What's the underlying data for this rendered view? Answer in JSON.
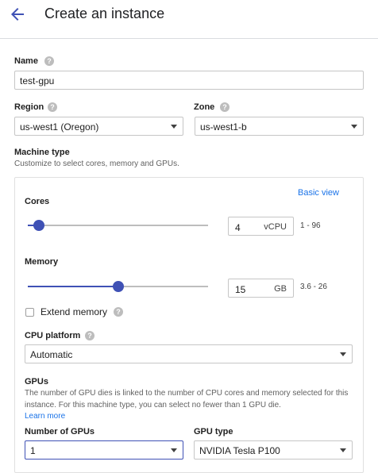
{
  "header": {
    "title": "Create an instance",
    "back_icon": "arrow-back-icon"
  },
  "name": {
    "label": "Name",
    "value": "test-gpu"
  },
  "region": {
    "label": "Region",
    "value": "us-west1 (Oregon)"
  },
  "zone": {
    "label": "Zone",
    "value": "us-west1-b"
  },
  "machine_type": {
    "label": "Machine type",
    "description": "Customize to select cores, memory and GPUs.",
    "basic_view_link": "Basic view",
    "cores": {
      "label": "Cores",
      "value": "4",
      "unit": "vCPU",
      "range": "1 - 96",
      "slider_fraction": 0.06
    },
    "memory": {
      "label": "Memory",
      "value": "15",
      "unit": "GB",
      "range": "3.6 - 26",
      "slider_fraction": 0.5
    },
    "extend_memory": {
      "label": "Extend memory",
      "checked": false
    },
    "cpu_platform": {
      "label": "CPU platform",
      "value": "Automatic"
    },
    "gpus": {
      "label": "GPUs",
      "description": "The number of GPU dies is linked to the number of CPU cores and memory selected for this instance. For this machine type, you can select no fewer than 1 GPU die.",
      "learn_more": "Learn more",
      "number_label": "Number of GPUs",
      "number_value": "1",
      "type_label": "GPU type",
      "type_value": "NVIDIA Tesla P100"
    }
  },
  "colors": {
    "accent": "#3f51b5",
    "link": "#1a73e8"
  }
}
